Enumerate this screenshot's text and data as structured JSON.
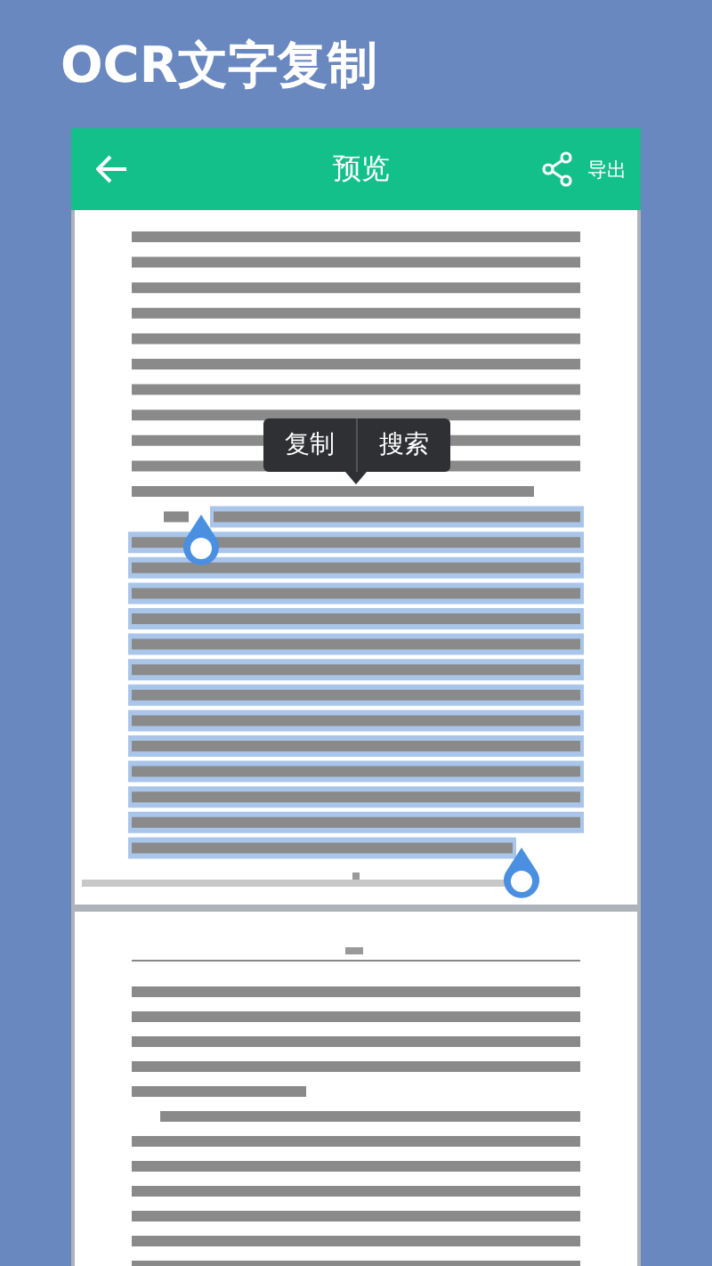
{
  "headline": "OCR文字复制",
  "app_bar": {
    "title": "预览",
    "action": "导出"
  },
  "document": {
    "pages": [
      {
        "kind": "picture",
        "highlighted": true
      },
      {
        "kind": "picture",
        "highlighted": false
      }
    ]
  },
  "selection_menu": {
    "items": [
      "复制",
      "搜索"
    ]
  }
}
